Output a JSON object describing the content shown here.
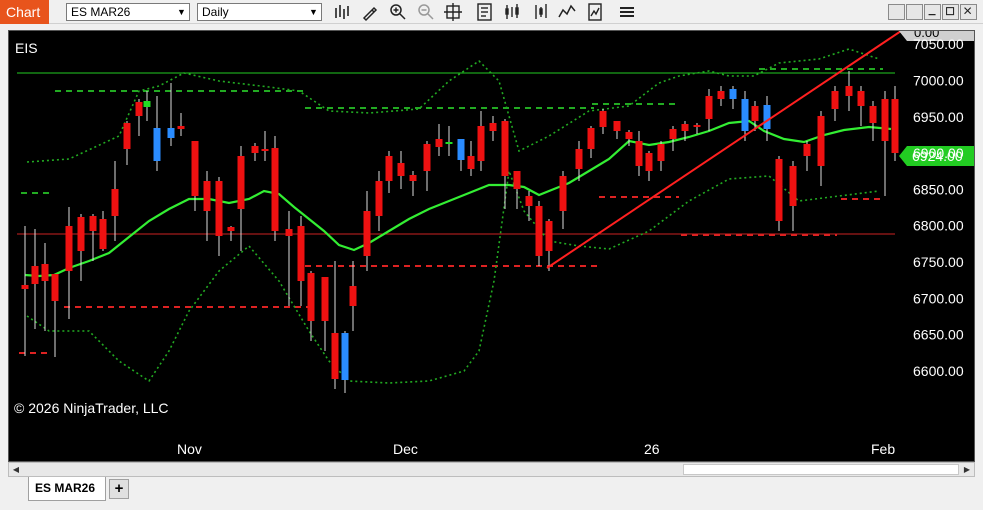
{
  "toolbar": {
    "app_tag": "Chart",
    "instrument": "ES MAR26",
    "interval": "Daily",
    "icons": [
      "bar-type-icon",
      "draw-pencil-icon",
      "zoom-in-icon",
      "zoom-out-icon",
      "crosshair-icon",
      "data-box-icon",
      "indicators-icon",
      "strategies-icon",
      "templates-icon",
      "properties-icon"
    ],
    "window_buttons": [
      "tile-icon",
      "minimize-icon",
      "maximize-icon",
      "close-icon"
    ]
  },
  "chart": {
    "label": "EIS",
    "copyright": "© 2026 NinjaTrader, LLC",
    "last_price": "6924.00",
    "top_price_partial": "0.00",
    "colors": {
      "background": "#000000",
      "up": "#22dd22",
      "down": "#ee1111",
      "neutral": "#2a8cff",
      "sma": "#33ee33",
      "band": "#22aa22",
      "trend": "#ff2020",
      "price_tag": "#22cc22"
    }
  },
  "chart_data": {
    "type": "candlestick",
    "y_ticks": [
      "7050.00",
      "7000.00",
      "6950.00",
      "6900.00",
      "6850.00",
      "6800.00",
      "6750.00",
      "6700.00",
      "6650.00",
      "6600.00"
    ],
    "x_ticks": [
      "Nov",
      "Dec",
      "26",
      "Feb"
    ],
    "ylim": [
      6575,
      7100
    ]
  },
  "tabs": {
    "active": "ES MAR26",
    "add": "+"
  }
}
